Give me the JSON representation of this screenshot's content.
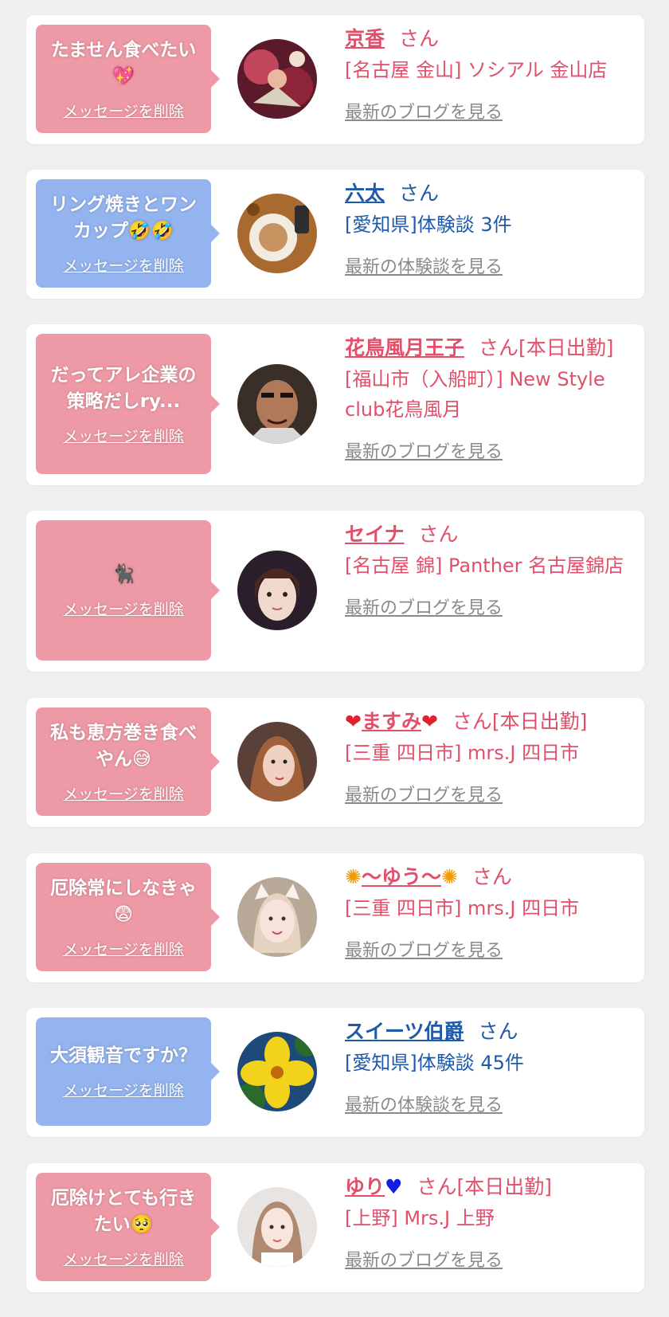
{
  "common": {
    "delete_label": "メッセージを削除",
    "san": "さん"
  },
  "cards": [
    {
      "message": "たません食べたい💖",
      "name": "京香",
      "san_suffix": "さん",
      "shop": "[名古屋 金山] ソシアル 金山店",
      "more": "最新のブログを見る",
      "avatar": "avatar-woman-flowers"
    },
    {
      "message": "リング焼きとワンカップ🤣🤣",
      "name": "六太",
      "san_suffix": "さん",
      "shop": "[愛知県]体験談 3件",
      "more": "最新の体験談を見る",
      "avatar": "avatar-food-plate"
    },
    {
      "message": "だってアレ企業の策略だしry...",
      "name": "花鳥風月王子",
      "san_suffix": "さん[本日出勤]",
      "shop": "[福山市（入船町）] New Style club花鳥風月",
      "more": "最新のブログを見る",
      "avatar": "avatar-man-face"
    },
    {
      "message": "🐈‍⬛",
      "name": "セイナ",
      "san_suffix": "さん",
      "shop": "[名古屋 錦] Panther 名古屋錦店",
      "more": "最新のブログを見る",
      "avatar": "avatar-woman-dark"
    },
    {
      "message": "私も恵方巻き食べやん😅",
      "name": "ますみ",
      "san_suffix": "さん[本日出勤]",
      "shop": "[三重 四日市] mrs.J 四日市",
      "more": "最新のブログを見る",
      "avatar": "avatar-woman-brown-hair"
    },
    {
      "message": "厄除常にしなきゃ😨",
      "name": "〜ゆう〜",
      "san_suffix": "さん",
      "shop": "[三重 四日市] mrs.J 四日市",
      "more": "最新のブログを見る",
      "avatar": "avatar-woman-cat-ears"
    },
    {
      "message": "大須観音ですか？",
      "name": "スイーツ伯爵",
      "san_suffix": "さん",
      "shop": "[愛知県]体験談 45件",
      "more": "最新の体験談を見る",
      "avatar": "avatar-yellow-flower"
    },
    {
      "message": "厄除けとても行きたい🥺",
      "name": "ゆり",
      "san_suffix": "さん[本日出勤]",
      "shop": "[上野] Mrs.J 上野",
      "more": "最新のブログを見る",
      "avatar": "avatar-woman-light"
    }
  ]
}
